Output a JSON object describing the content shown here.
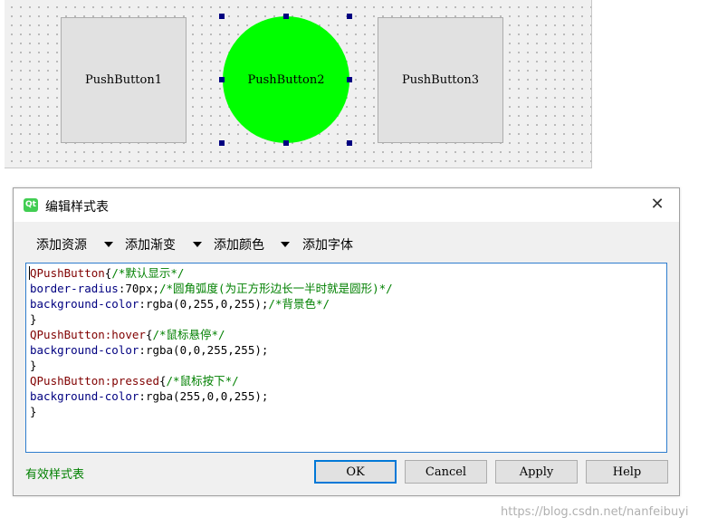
{
  "form": {
    "buttons": [
      {
        "label": "PushButton1"
      },
      {
        "label": "PushButton2"
      },
      {
        "label": "PushButton3"
      }
    ],
    "round_button_color": "#00ff00",
    "selection_handle_color": "#000080"
  },
  "dialog": {
    "title": "编辑样式表",
    "app_icon": "qt-logo-icon",
    "app_icon_text": "Qt",
    "close_icon": "close-icon",
    "toolbar": [
      {
        "label": "添加资源",
        "has_dropdown": true
      },
      {
        "label": "添加渐变",
        "has_dropdown": true
      },
      {
        "label": "添加颜色",
        "has_dropdown": true
      },
      {
        "label": "添加字体",
        "has_dropdown": false
      }
    ],
    "editor_lines": [
      [
        {
          "t": "QPushButton",
          "c": "c-sel"
        },
        {
          "t": "{",
          "c": "c-plain"
        },
        {
          "t": "/*默认显示*/",
          "c": "c-cmt"
        }
      ],
      [
        {
          "t": "border-radius",
          "c": "c-prop"
        },
        {
          "t": ":70px;",
          "c": "c-plain"
        },
        {
          "t": "/*圆角弧度(为正方形边长一半时就是圆形)*/",
          "c": "c-cmt"
        }
      ],
      [
        {
          "t": "background-color",
          "c": "c-prop"
        },
        {
          "t": ":rgba(0,255,0,255);",
          "c": "c-plain"
        },
        {
          "t": "/*背景色*/",
          "c": "c-cmt"
        }
      ],
      [
        {
          "t": "}",
          "c": "c-plain"
        }
      ],
      [
        {
          "t": "QPushButton:hover",
          "c": "c-sel"
        },
        {
          "t": "{",
          "c": "c-plain"
        },
        {
          "t": "/*鼠标悬停*/",
          "c": "c-cmt"
        }
      ],
      [
        {
          "t": "background-color",
          "c": "c-prop"
        },
        {
          "t": ":rgba(0,0,255,255);",
          "c": "c-plain"
        }
      ],
      [
        {
          "t": "}",
          "c": "c-plain"
        }
      ],
      [
        {
          "t": "QPushButton:pressed",
          "c": "c-sel"
        },
        {
          "t": "{",
          "c": "c-plain"
        },
        {
          "t": "/*鼠标按下*/",
          "c": "c-cmt"
        }
      ],
      [
        {
          "t": "background-color",
          "c": "c-prop"
        },
        {
          "t": ":rgba(255,0,0,255);",
          "c": "c-plain"
        }
      ],
      [
        {
          "t": "}",
          "c": "c-plain"
        }
      ]
    ],
    "status": "有效样式表",
    "buttons": {
      "ok": "OK",
      "cancel": "Cancel",
      "apply": "Apply",
      "help": "Help"
    }
  },
  "watermark": "https://blog.csdn.net/nanfeibuyi"
}
